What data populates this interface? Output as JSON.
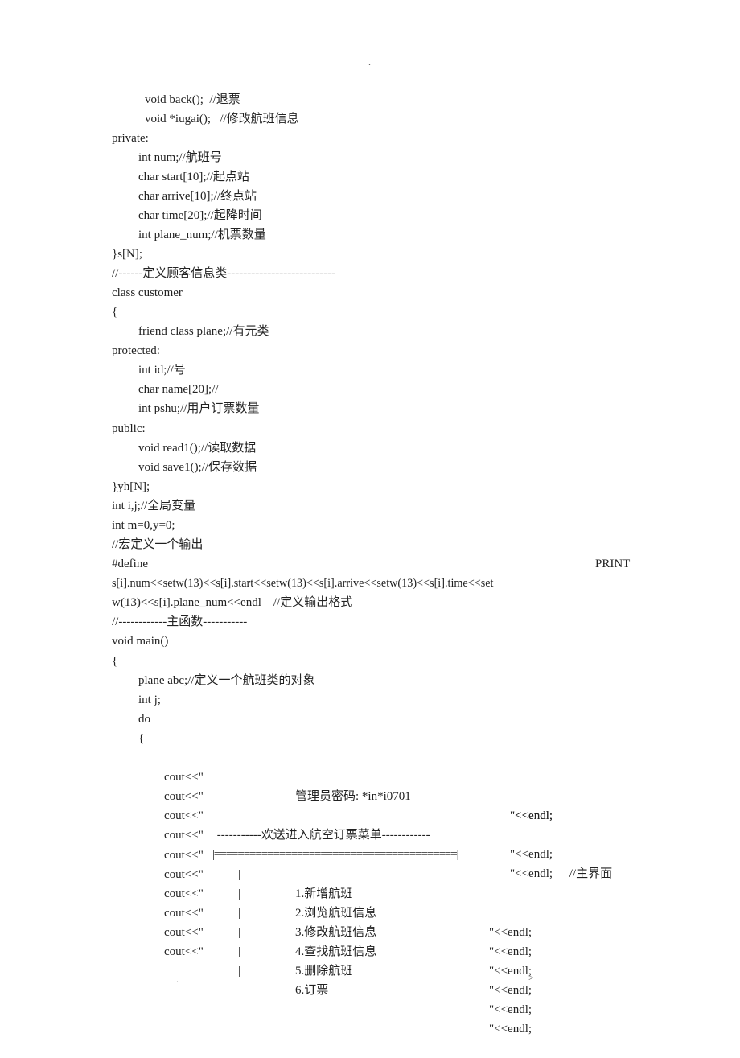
{
  "header_mark": ".",
  "footer_left": ".",
  "footer_right": ">",
  "lines": [
    "void back();  //退票",
    "void *iugai();   //修改航班信息",
    "private:",
    "int num;//航班号",
    "char start[10];//起点站",
    "char arrive[10];//终点站",
    "char time[20];//起降时间",
    "int plane_num;//机票数量",
    "}s[N];",
    "//------定义顾客信息类---------------------------",
    "class customer",
    "{",
    "friend class plane;//有元类",
    "protected:",
    "int id;//号",
    "char name[20];//",
    "int pshu;//用户订票数量",
    "public:",
    "void read1();//读取数据",
    "void save1();//保存数据",
    "}yh[N];",
    "int i,j;//全局变量",
    "int m=0,y=0;",
    "//宏定义一个输出",
    "#define",
    "s[i].num<<setw(13)<<s[i].start<<setw(13)<<s[i].arrive<<setw(13)<<s[i].time<<set",
    "w(13)<<s[i].plane_num<<endl    //定义输出格式",
    "//------------主函数-----------",
    "void main()",
    "{",
    "plane abc;//定义一个航班类的对象",
    "int j;",
    "do",
    "{"
  ],
  "define_name": "PRINT",
  "menu": {
    "prefix": "cout<<\"",
    "suffix": "\"<<endl;",
    "password_line": "管理员密码: *in*i0701",
    "title_line": " -----------欢送进入航空订票菜单------------",
    "title_comment": " //主界面",
    "separator": "|=========================================|",
    "pipe": "|",
    "items": [
      "1.新增航班",
      "2.浏览航班信息",
      "3.修改航班信息",
      "4.查找航班信息",
      "5.删除航班",
      "6.订票"
    ]
  }
}
